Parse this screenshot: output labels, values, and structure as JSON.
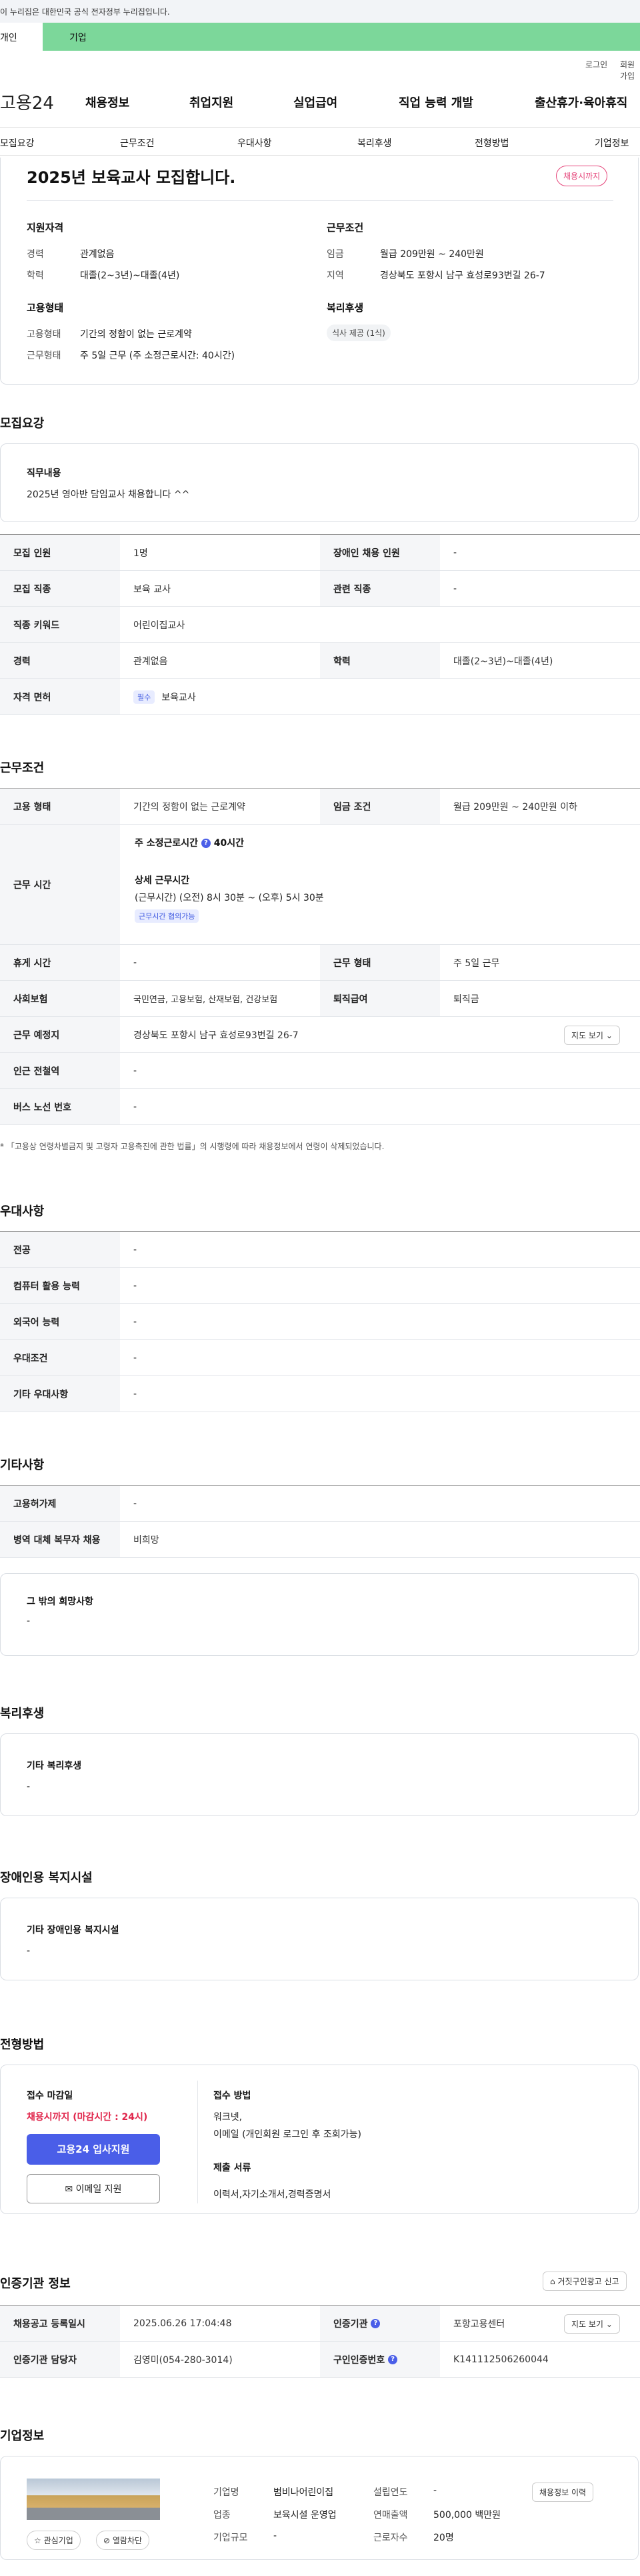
{
  "banner": "이 누리집은 대한민국 공식 전자정부 누리집입니다.",
  "topTabs": [
    "개인",
    "기업"
  ],
  "util": [
    "로그인",
    "회원가입"
  ],
  "logo": "고용24",
  "gnb": [
    "채용정보",
    "취업지원",
    "실업급여",
    "직업 능력 개발",
    "출산휴가·육아휴직"
  ],
  "snb": [
    "모집요강",
    "근무조건",
    "우대사항",
    "복리후생",
    "전형방법",
    "기업정보"
  ],
  "title": "2025년 보육교사 모집합니다.",
  "titleBadge": "채용시까지",
  "summary": {
    "qual": {
      "h": "지원자격",
      "l1": "경력",
      "v1": "관계없음",
      "l2": "학력",
      "v2": "대졸(2~3년)~대졸(4년)"
    },
    "cond": {
      "h": "근무조건",
      "l1": "임금",
      "v1": "월급 209만원 ~ 240만원",
      "l2": "지역",
      "v2": "경상북도 포항시 남구 효성로93번길 26-7"
    },
    "emp": {
      "h": "고용형태",
      "l1": "고용형태",
      "v1": "기간의 정함이 없는 근로계약",
      "l2": "근무형태",
      "v2": "주 5일 근무 (주 소정근로시간: 40시간)"
    },
    "welfare": {
      "h": "복리후생",
      "chip": "식사 제공 (1식)"
    }
  },
  "recruit": {
    "section": "모집요강",
    "dutyH": "직무내용",
    "dutyV": "2025년 영아반 담임교사 채용합니다 ^^",
    "rows": [
      {
        "l1": "모집 인원",
        "v1": "1명",
        "l2": "장애인 채용 인원",
        "v2": "-"
      },
      {
        "l1": "모집 직종",
        "v1": "보육 교사",
        "l2": "관련 직종",
        "v2": "-"
      },
      {
        "l1": "직종 키워드",
        "v1": "어린이집교사"
      },
      {
        "l1": "경력",
        "v1": "관계없음",
        "l2": "학력",
        "v2": "대졸(2~3년)~대졸(4년)"
      },
      {
        "l1": "자격 면허",
        "tag": "필수",
        "v1": "보육교사"
      }
    ]
  },
  "work": {
    "section": "근무조건",
    "r1": {
      "l1": "고용 형태",
      "v1": "기간의 정함이 없는 근로계약",
      "l2": "임금 조건",
      "v2": "월급 209만원 ~ 240만원 이하"
    },
    "hours": {
      "l": "근무 시간",
      "a": "주 소정근로시간",
      "aval": "40시간",
      "b": "상세 근무시간",
      "c": "(근무시간) (오전) 8시 30분 ~ (오후) 5시 30분",
      "tag": "근무시간 협의가능"
    },
    "r3": {
      "l1": "휴게 시간",
      "v1": "-",
      "l2": "근무 형태",
      "v2": "주 5일 근무"
    },
    "r4": {
      "l1": "사회보험",
      "v1": "국민연금, 고용보험, 산재보험, 건강보험",
      "l2": "퇴직급여",
      "v2": "퇴직금"
    },
    "r5": {
      "l1": "근무 예정지",
      "v1": "경상북도 포항시 남구 효성로93번길 26-7",
      "btn": "지도 보기"
    },
    "r6": {
      "l1": "인근 전철역",
      "v1": "-"
    },
    "r7": {
      "l1": "버스 노선 번호",
      "v1": "-"
    },
    "note": "「고용상 연령차별금지 및 고령자 고용촉진에 관한 법률」의 시행령에 따라 채용정보에서 연령이 삭제되었습니다."
  },
  "pref": {
    "section": "우대사항",
    "rows": [
      [
        "전공",
        "-"
      ],
      [
        "컴퓨터 활용 능력",
        "-"
      ],
      [
        "외국어 능력",
        "-"
      ],
      [
        "우대조건",
        "-"
      ],
      [
        "기타 우대사항",
        "-"
      ]
    ]
  },
  "etc": {
    "section": "기타사항",
    "rows": [
      [
        "고용허가제",
        "-"
      ],
      [
        "병역 대체 복무자 채용",
        "비희망"
      ]
    ],
    "boxH": "그 밖의 희망사항",
    "boxV": "-"
  },
  "welfare": {
    "section": "복리후생",
    "h": "기타 복리후생",
    "v": "-"
  },
  "disab": {
    "section": "장애인용 복지시설",
    "h": "기타 장애인용 복지시설",
    "v": "-"
  },
  "select": {
    "section": "전형방법",
    "deadlineH": "접수 마감일",
    "deadlineV": "채용시까지 (마감시간 : 24시)",
    "applyBtn": "고용24 입사지원",
    "emailBtn": "이메일 지원",
    "methodH": "접수 방법",
    "method1": "워크넷,",
    "method2": "이메일 (개인회원 로그인 후 조회가능)",
    "docsH": "제출 서류",
    "docsV": "이력서,자기소개서,경력증명서"
  },
  "agency": {
    "section": "인증기관 정보",
    "reportBtn": "거짓구인광고 신고",
    "r1": {
      "l1": "채용공고 등록일시",
      "v1": "2025.06.26 17:04:48",
      "l2": "인증기관",
      "v2": "포항고용센터",
      "btn": "지도 보기"
    },
    "r2": {
      "l1": "인증기관 담당자",
      "v1": "김영미(054-280-3014)",
      "l2": "구인인증번호",
      "v2": "K141112506260044"
    }
  },
  "company": {
    "section": "기업정보",
    "name_l": "기업명",
    "name_v": "범비나어린이집",
    "est_l": "설립연도",
    "est_v": "-",
    "ind_l": "업종",
    "ind_v": "보육시설 운영업",
    "sales_l": "연매출액",
    "sales_v": "500,000 백만원",
    "size_l": "기업규모",
    "size_v": "-",
    "emp_l": "근로자수",
    "emp_v": "20명",
    "histBtn": "채용정보 이력",
    "favBtn": "관심기업",
    "blockBtn": "열람차단"
  },
  "colors": {
    "green": "#7cd79a",
    "accentBlue": "#4a5ee8",
    "badgePink": "#e5457a",
    "deadlineRed": "#e0244a"
  }
}
